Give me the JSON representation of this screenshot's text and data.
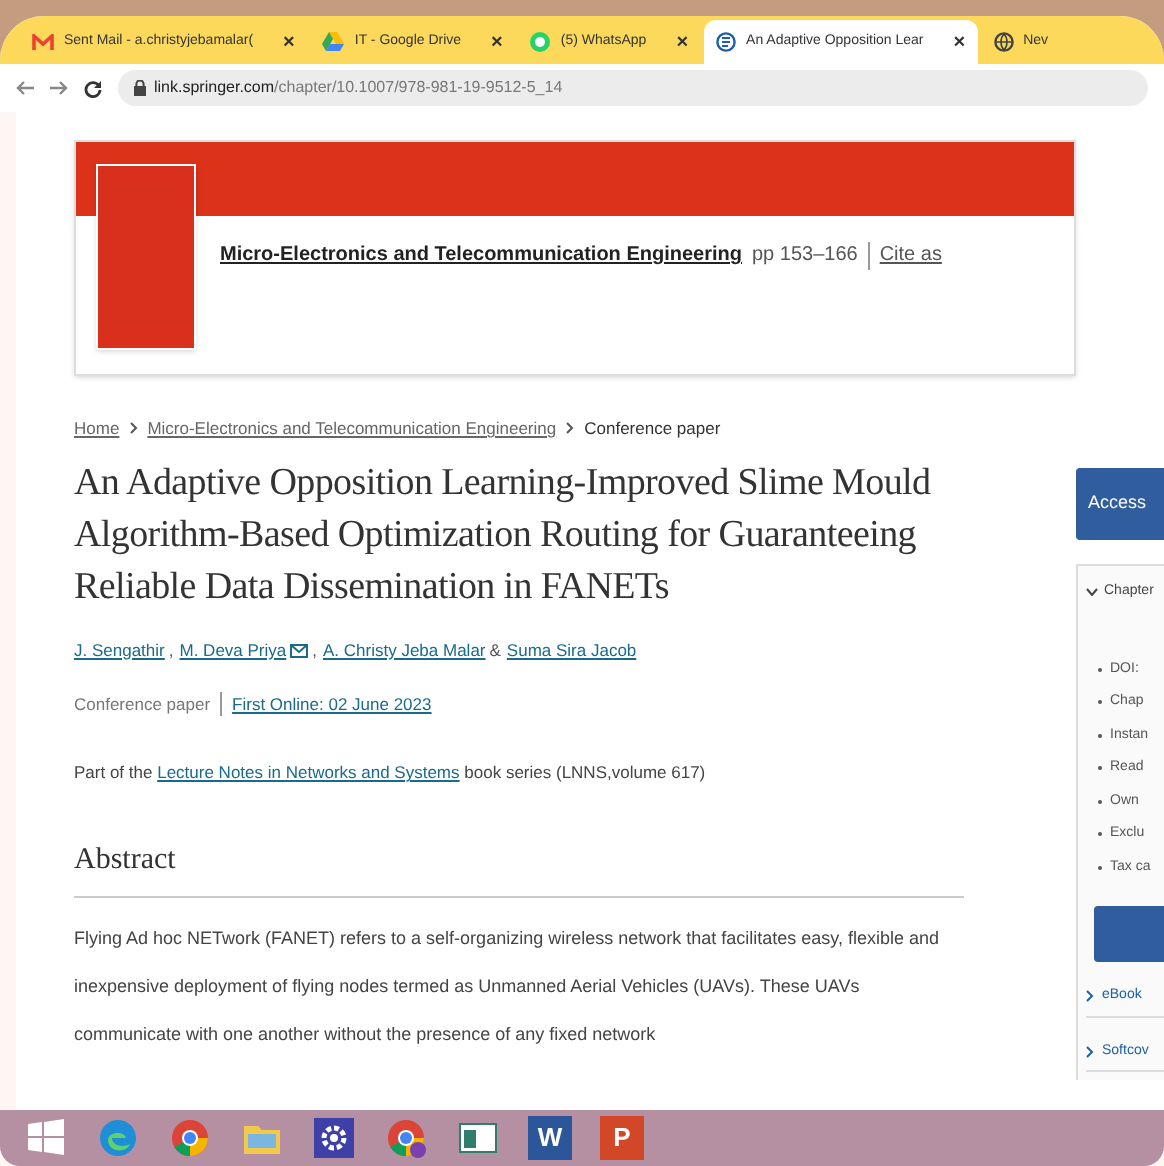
{
  "tabs": [
    {
      "kind": "mail",
      "title": "Sent Mail - a.christyjebamalar(",
      "close": "×",
      "selected": false
    },
    {
      "kind": "drive",
      "title": "IT - Google Drive",
      "close": "×",
      "selected": false
    },
    {
      "kind": "chat",
      "title": "(5) WhatsApp",
      "close": "×",
      "selected": false
    },
    {
      "kind": "page",
      "title": "An Adaptive Opposition Lear",
      "close": "×",
      "selected": true
    },
    {
      "kind": "globe",
      "title": "Nev",
      "selected": false
    }
  ],
  "address": {
    "host": "link.springer.com",
    "path": "/chapter/10.1007/978-981-19-9512-5_14"
  },
  "book": {
    "title": "Micro-Electronics and Telecommunication Engineering",
    "pages": "pp 153–166",
    "cite": "Cite as"
  },
  "breadcrumb": [
    {
      "label": "Home",
      "link": true
    },
    {
      "label": "Micro-Electronics and Telecommunication Engineering",
      "link": true
    },
    {
      "label": "Conference paper",
      "link": false
    }
  ],
  "title": "An Adaptive Opposition Learning-Improved Slime Mould Algorithm-Based Optimization Routing for Guaranteeing Reliable Data Dissemination in FANETs",
  "authors": [
    {
      "name": "J. Sengathir",
      "sep": ",",
      "mail": false
    },
    {
      "name": "M. Deva Priya",
      "sep": ",",
      "mail": true
    },
    {
      "name": "A. Christy Jeba Malar",
      "sep": "&",
      "mail": false
    },
    {
      "name": "Suma Sira Jacob",
      "mail": false
    }
  ],
  "meta": {
    "type": "Conference paper",
    "online": "First Online: 02 June 2023"
  },
  "series": {
    "before": "Part of the",
    "link": "Lecture Notes in Networks and Systems",
    "after": "book series (LNNS,volume 617)"
  },
  "abstract": {
    "heading": "Abstract",
    "text": "Flying Ad hoc NETwork (FANET) refers to a self-organizing wireless network that facilitates easy, flexible and inexpensive deployment of flying nodes termed as Unmanned Aerial Vehicles (UAVs). These UAVs communicate with one another without the presence of any fixed network"
  },
  "sidebar": {
    "access": "Access",
    "panel_title": "Chapter",
    "bullets": [
      "DOI:",
      "Chap",
      "Instan",
      "Read",
      "Own",
      "Exclu",
      "Tax ca"
    ],
    "links": [
      "eBook",
      "Softcov"
    ]
  },
  "taskbar": [
    {
      "kind": "start"
    },
    {
      "kind": "edge"
    },
    {
      "kind": "chrome"
    },
    {
      "kind": "folder"
    },
    {
      "kind": "gear"
    },
    {
      "kind": "chrome2"
    },
    {
      "kind": "app"
    },
    {
      "kind": "word",
      "letter": "W"
    },
    {
      "kind": "ppt",
      "letter": "P"
    }
  ]
}
